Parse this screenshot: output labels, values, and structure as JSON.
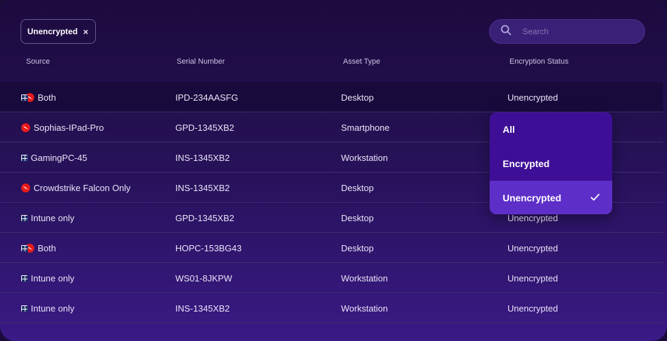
{
  "filter_chip": {
    "label": "Unencrypted",
    "close_glyph": "×"
  },
  "search": {
    "placeholder": "Search",
    "icon": "search-icon"
  },
  "columns": [
    "Source",
    "Serial Number",
    "Asset Type",
    "Encryption Status"
  ],
  "rows": [
    {
      "source": "Both",
      "source_icons": [
        "windows-icon",
        "crowdstrike-icon"
      ],
      "serial": "IPD-234AASFG",
      "asset_type": "Desktop",
      "status": "Unencrypted"
    },
    {
      "source": "Sophias-IPad-Pro",
      "source_icons": [
        "crowdstrike-icon"
      ],
      "serial": "GPD-1345XB2",
      "asset_type": "Smartphone",
      "status": ""
    },
    {
      "source": "GamingPC-45",
      "source_icons": [
        "windows-icon"
      ],
      "serial": "INS-1345XB2",
      "asset_type": "Workstation",
      "status": ""
    },
    {
      "source": "Crowdstrike Falcon Only",
      "source_icons": [
        "crowdstrike-icon"
      ],
      "serial": "INS-1345XB2",
      "asset_type": "Desktop",
      "status": ""
    },
    {
      "source": "Intune only",
      "source_icons": [
        "windows-icon"
      ],
      "serial": "GPD-1345XB2",
      "asset_type": "Desktop",
      "status": "Unencrypted"
    },
    {
      "source": "Both",
      "source_icons": [
        "windows-icon",
        "crowdstrike-icon"
      ],
      "serial": "HOPC-153BG43",
      "asset_type": "Desktop",
      "status": "Unencrypted"
    },
    {
      "source": "Intune only",
      "source_icons": [
        "windows-icon"
      ],
      "serial": "WS01-8JKPW",
      "asset_type": "Workstation",
      "status": "Unencrypted"
    },
    {
      "source": "Intune only",
      "source_icons": [
        "windows-icon"
      ],
      "serial": "INS-1345XB2",
      "asset_type": "Workstation",
      "status": "Unencrypted"
    }
  ],
  "dropdown": {
    "options": [
      "All",
      "Encrypted",
      "Unencrypted"
    ],
    "selected": "Unencrypted",
    "check_icon": "check-icon"
  },
  "colors": {
    "background": "#23104f",
    "dropdown": "#3e0f96",
    "dropdown_selected": "#5e2fc8",
    "crowdstrike": "#e81a1a"
  }
}
